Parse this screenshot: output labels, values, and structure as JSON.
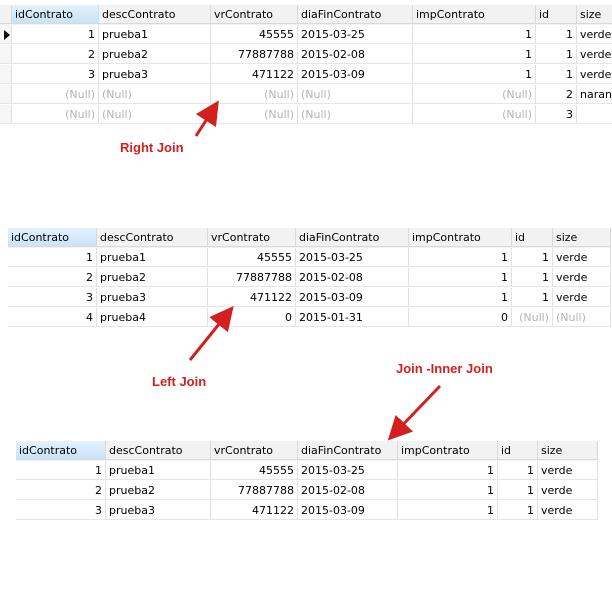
{
  "columns": [
    "idContrato",
    "descContrato",
    "vrContrato",
    "diaFinContrato",
    "impContrato",
    "id",
    "size"
  ],
  "null_text": "(Null)",
  "annotation_color": "#d41f1f",
  "grids": [
    {
      "name": "right-join-grid",
      "caption": "Right Join",
      "rows": [
        [
          "1",
          "prueba1",
          "45555",
          "2015-03-25",
          "1",
          "1",
          "verde"
        ],
        [
          "2",
          "prueba2",
          "77887788",
          "2015-02-08",
          "1",
          "1",
          "verde"
        ],
        [
          "3",
          "prueba3",
          "471122",
          "2015-03-09",
          "1",
          "1",
          "verde"
        ],
        [
          null,
          null,
          null,
          null,
          null,
          "2",
          "naranja"
        ],
        [
          null,
          null,
          null,
          null,
          null,
          "3",
          ""
        ]
      ]
    },
    {
      "name": "left-join-grid",
      "caption": "Left Join",
      "rows": [
        [
          "1",
          "prueba1",
          "45555",
          "2015-03-25",
          "1",
          "1",
          "verde"
        ],
        [
          "2",
          "prueba2",
          "77887788",
          "2015-02-08",
          "1",
          "1",
          "verde"
        ],
        [
          "3",
          "prueba3",
          "471122",
          "2015-03-09",
          "1",
          "1",
          "verde"
        ],
        [
          "4",
          "prueba4",
          "0",
          "2015-01-31",
          "0",
          null,
          null
        ]
      ]
    },
    {
      "name": "inner-join-grid",
      "caption": "Join -Inner Join",
      "rows": [
        [
          "1",
          "prueba1",
          "45555",
          "2015-03-25",
          "1",
          "1",
          "verde"
        ],
        [
          "2",
          "prueba2",
          "77887788",
          "2015-02-08",
          "1",
          "1",
          "verde"
        ],
        [
          "3",
          "prueba3",
          "471122",
          "2015-03-09",
          "1",
          "1",
          "verde"
        ]
      ]
    }
  ]
}
